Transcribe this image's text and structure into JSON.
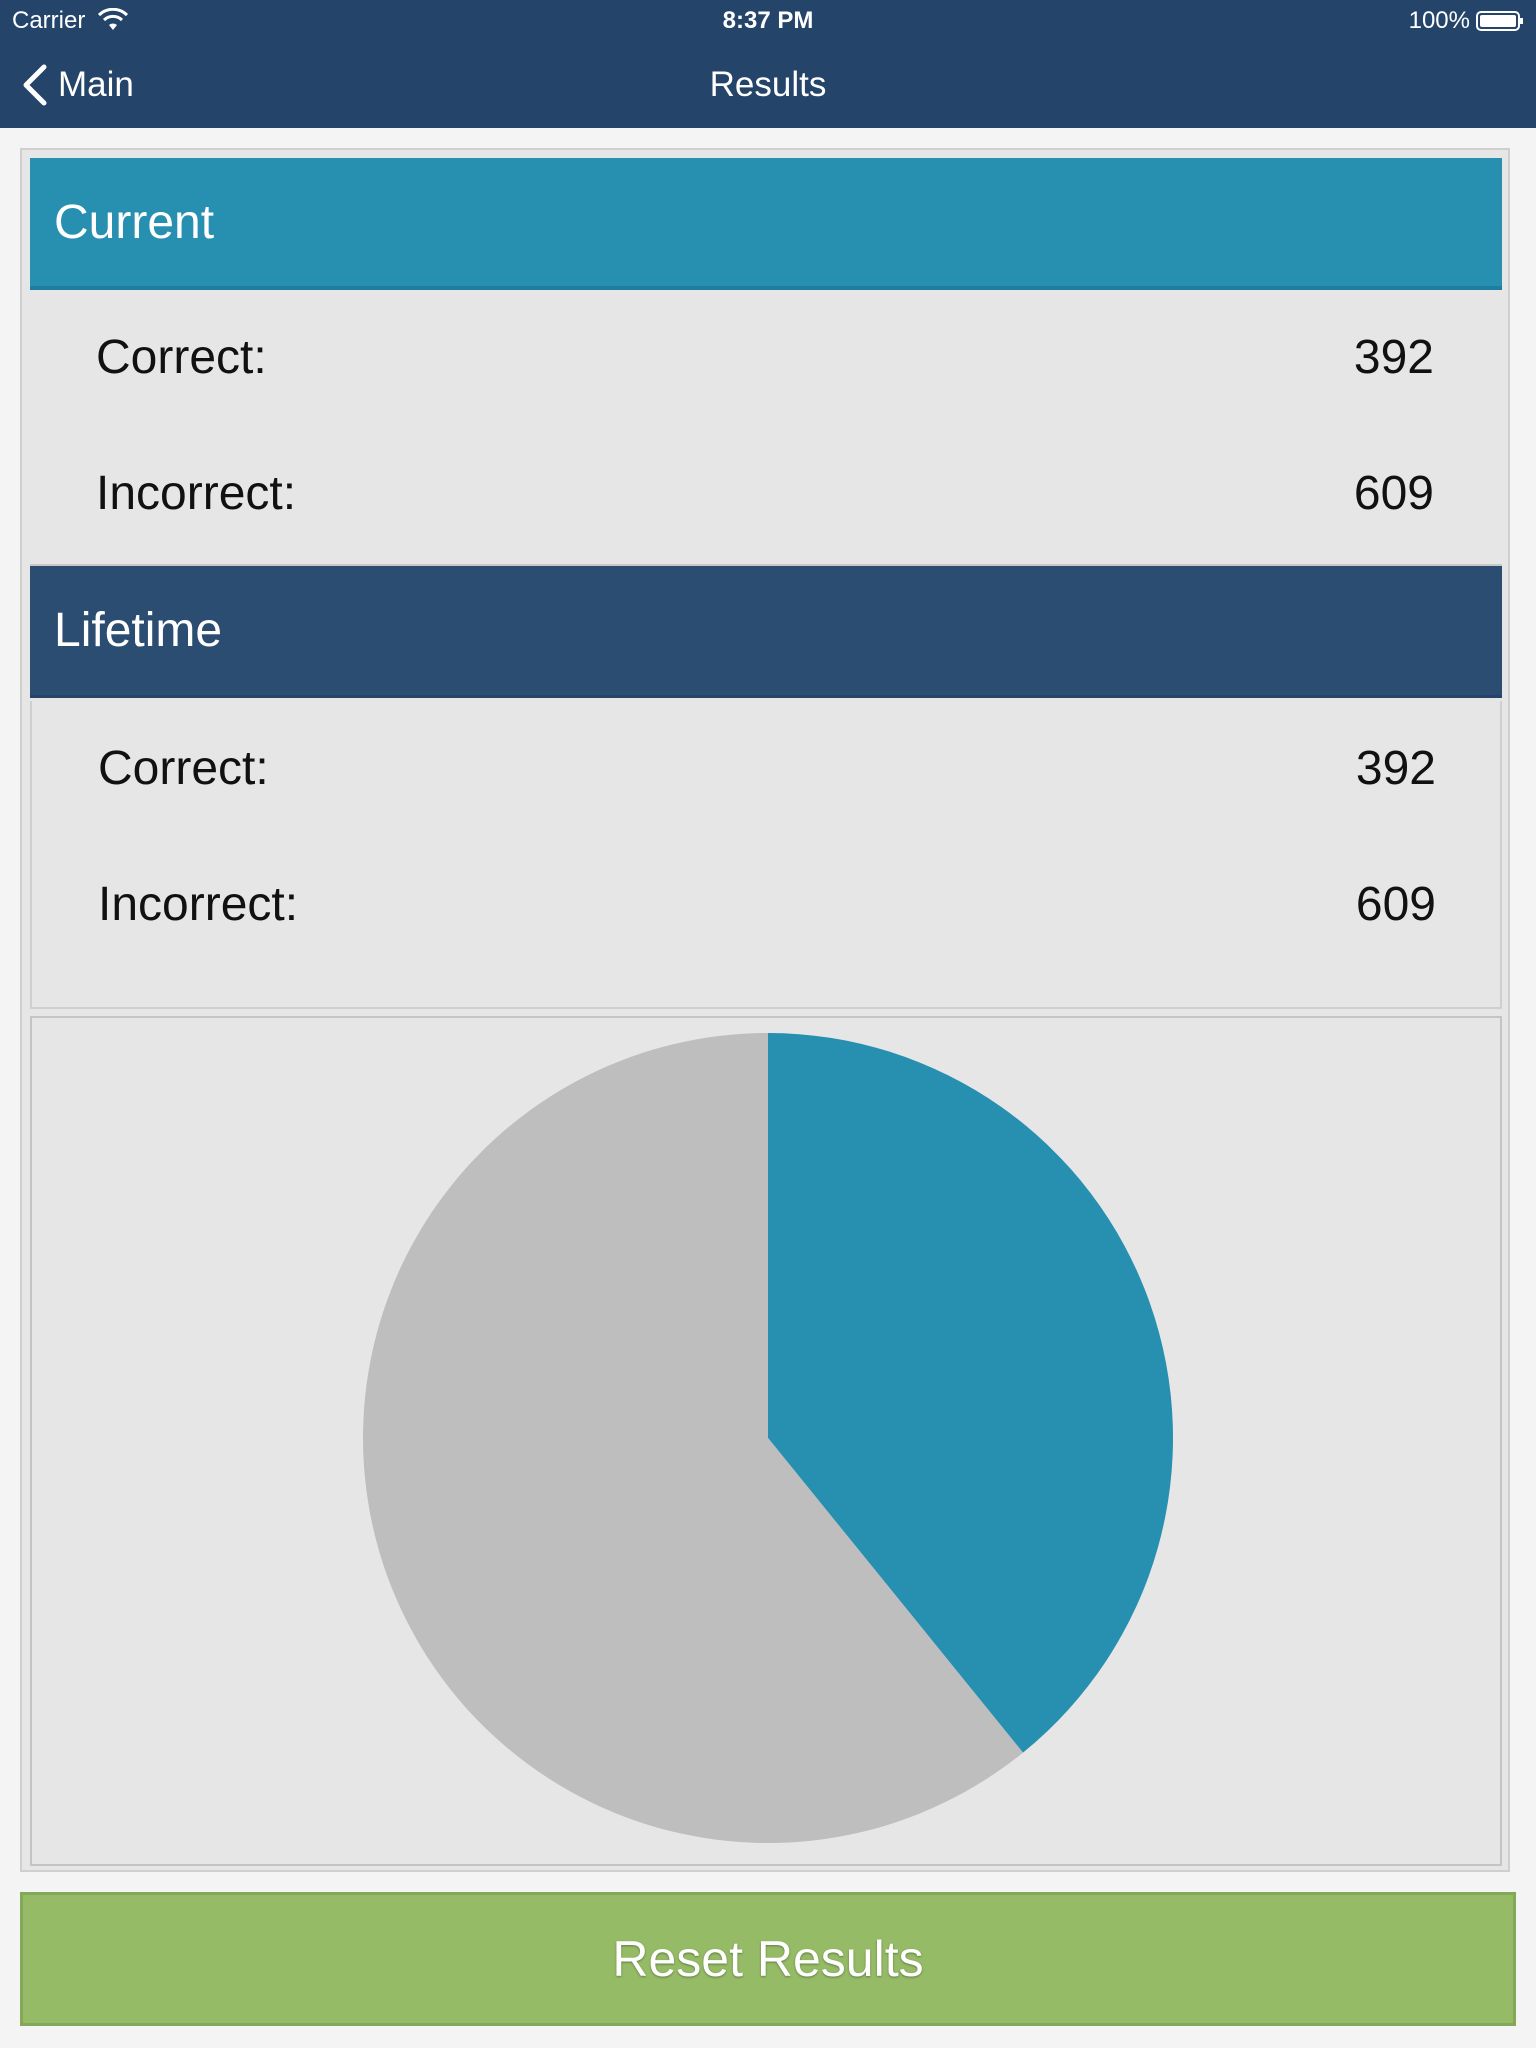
{
  "status_bar": {
    "carrier": "Carrier",
    "time": "8:37 PM",
    "battery": "100%"
  },
  "nav": {
    "back_label": "Main",
    "title": "Results"
  },
  "sections": {
    "current": {
      "title": "Current",
      "correct_label": "Correct:",
      "correct_value": "392",
      "incorrect_label": "Incorrect:",
      "incorrect_value": "609"
    },
    "lifetime": {
      "title": "Lifetime",
      "correct_label": "Correct:",
      "correct_value": "392",
      "incorrect_label": "Incorrect:",
      "incorrect_value": "609"
    }
  },
  "chart_data": {
    "type": "pie",
    "slices": [
      {
        "value": 392,
        "color": "#2790b1"
      },
      {
        "value": 609,
        "color": "#bebebe"
      }
    ],
    "start_angle": "top",
    "direction": "clockwise"
  },
  "actions": {
    "reset_label": "Reset Results"
  },
  "colors": {
    "nav_bar": "#24446a",
    "current_header": "#2790b1",
    "lifetime_header": "#2c4d72",
    "reset_button": "#95bb66"
  }
}
